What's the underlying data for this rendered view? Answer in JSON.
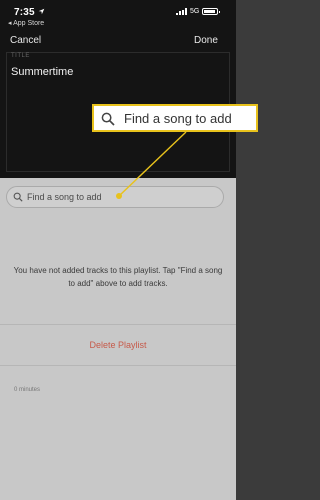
{
  "status_bar": {
    "time": "7:35",
    "back_app": "◂ App Store",
    "network": "5G"
  },
  "nav": {
    "cancel_label": "Cancel",
    "done_label": "Done"
  },
  "title_field": {
    "label": "TITLE",
    "value": "Summertime"
  },
  "search": {
    "placeholder": "Find a song to add"
  },
  "callout": {
    "text": "Find a song to add",
    "highlight_color": "#e8c21c"
  },
  "empty_state": {
    "message": "You have not added tracks to this playlist. Tap \"Find a song to add\" above to add tracks."
  },
  "actions": {
    "delete_label": "Delete Playlist",
    "delete_color": "#c65a4a"
  },
  "footer": {
    "duration": "0 minutes"
  }
}
